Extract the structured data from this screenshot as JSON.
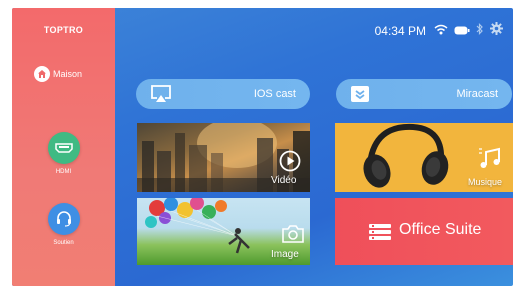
{
  "sidebar": {
    "brand": "TOPTRO",
    "home_label": "Maison",
    "hdmi_label": "HDMI",
    "support_label": "Soutien"
  },
  "status": {
    "time": "04:34 PM",
    "icons": [
      "wifi-icon",
      "battery-icon",
      "bluetooth-icon",
      "gear-icon"
    ]
  },
  "cast": {
    "ios_label": "IOS cast",
    "miracast_label": "Miracast"
  },
  "tiles": {
    "video_label": "Vidéo",
    "music_label": "Musique",
    "image_label": "Image",
    "office_label": "Office Suite"
  },
  "colors": {
    "sidebar": "#f36a6b",
    "background": "#2f73d6",
    "hdmi": "#3fba83",
    "support": "#3f8fe4",
    "music_tile": "#f2b53d",
    "office_tile": "#ef4f5a"
  }
}
